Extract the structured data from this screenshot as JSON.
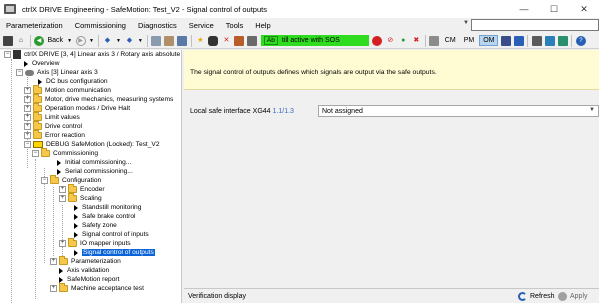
{
  "window": {
    "title": "ctrlX DRIVE Engineering - SafeMotion: Test_V2 - Signal control of outputs",
    "minimize": "—",
    "maximize": "☐",
    "close": "✕"
  },
  "menu": {
    "items": [
      "Parameterization",
      "Commissioning",
      "Diagnostics",
      "Service",
      "Tools",
      "Help"
    ],
    "search_value": ""
  },
  "toolbar": {
    "back_label": "Back",
    "status_badge": "Ab",
    "status_text": "till active with SOS",
    "status_color": "#2fdc1f",
    "modes": [
      "CM",
      "PM",
      "OM"
    ],
    "active_mode": "OM"
  },
  "tree": {
    "items": [
      {
        "label": "ctrlX DRIVE [3, 4] Linear axis 3 / Rotary axis absolute"
      },
      {
        "label": "Overview"
      },
      {
        "label": "Axis [3] Linear axis 3"
      },
      {
        "label": "DC bus configuration"
      },
      {
        "label": "Motion communication"
      },
      {
        "label": "Motor, drive mechanics, measuring systems"
      },
      {
        "label": "Operation modes / Drive Halt"
      },
      {
        "label": "Limit values"
      },
      {
        "label": "Drive control"
      },
      {
        "label": "Error reaction"
      },
      {
        "label": "DEBUG SafeMotion (Locked): Test_V2"
      },
      {
        "label": "Commissioning"
      },
      {
        "label": "Initial commissioning..."
      },
      {
        "label": "Serial commissioning..."
      },
      {
        "label": "Configuration"
      },
      {
        "label": "Encoder"
      },
      {
        "label": "Scaling"
      },
      {
        "label": "Standstill monitoring"
      },
      {
        "label": "Safe brake control"
      },
      {
        "label": "Safety zone"
      },
      {
        "label": "Signal control of inputs"
      },
      {
        "label": "IO mapper inputs"
      },
      {
        "label": "Signal control of outputs"
      },
      {
        "label": "Parameterization"
      },
      {
        "label": "Axis validation"
      },
      {
        "label": "SafeMotion report"
      },
      {
        "label": "Machine acceptance test"
      }
    ]
  },
  "main": {
    "info_text": "The signal control of outputs defines which signals are output via the safe outputs.",
    "field_label": "Local safe interface XG44",
    "field_version": "1.1/1.3",
    "field_value": "Not assigned",
    "verification_label": "Verification display",
    "refresh_label": "Refresh",
    "apply_label": "Apply"
  }
}
